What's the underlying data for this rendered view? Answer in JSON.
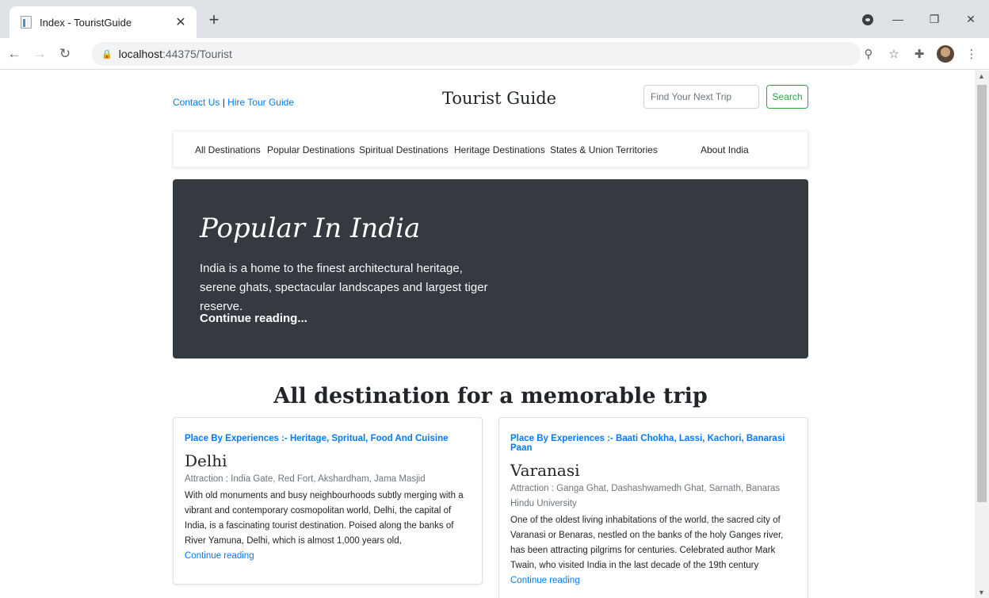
{
  "browser": {
    "tab_title": "Index - TouristGuide",
    "url_host": "localhost",
    "url_rest": ":44375/Tourist"
  },
  "header": {
    "contact_link": "Contact Us",
    "separator": "|",
    "hire_link": "Hire Tour Guide",
    "site_title": "Tourist Guide",
    "search_placeholder": "Find Your Next Trip",
    "search_button": "Search"
  },
  "nav": {
    "items": [
      "All Destinations",
      "Popular Destinations",
      "Spiritual Destinations",
      "Heritage Destinations",
      "States & Union Territories",
      "About India"
    ]
  },
  "hero": {
    "title": "Popular In India",
    "text": "India is a home to the finest architectural heritage, serene ghats, spectacular landscapes and largest tiger reserve.",
    "link": "Continue reading..."
  },
  "section": {
    "title": "All destination for a memorable trip"
  },
  "cards": [
    {
      "experiences": "Place By Experiences :- Heritage, Spritual, Food And Cuisine",
      "title": "Delhi",
      "attraction": "Attraction : India Gate, Red Fort, Akshardham, Jama Masjid",
      "description": "With old monuments and busy neighbourhoods subtly merging with a vibrant and contemporary cosmopolitan world, Delhi, the capital of India, is a fascinating tourist destination. Poised along the banks of River Yamuna, Delhi, which is almost 1,000 years old,",
      "link": "Continue reading"
    },
    {
      "experiences": "Place By Experiences :- Baati Chokha, Lassi, Kachori, Banarasi Paan",
      "title": "Varanasi",
      "attraction": "Attraction : Ganga Ghat, Dashashwamedh Ghat, Sarnath, Banaras Hindu University",
      "description": "One of the oldest living inhabitations of the world, the sacred city of Varanasi or Benaras, nestled on the banks of the holy Ganges river, has been attracting pilgrims for centuries. Celebrated author Mark Twain, who visited India in the last decade of the 19th century",
      "link": "Continue reading"
    }
  ]
}
